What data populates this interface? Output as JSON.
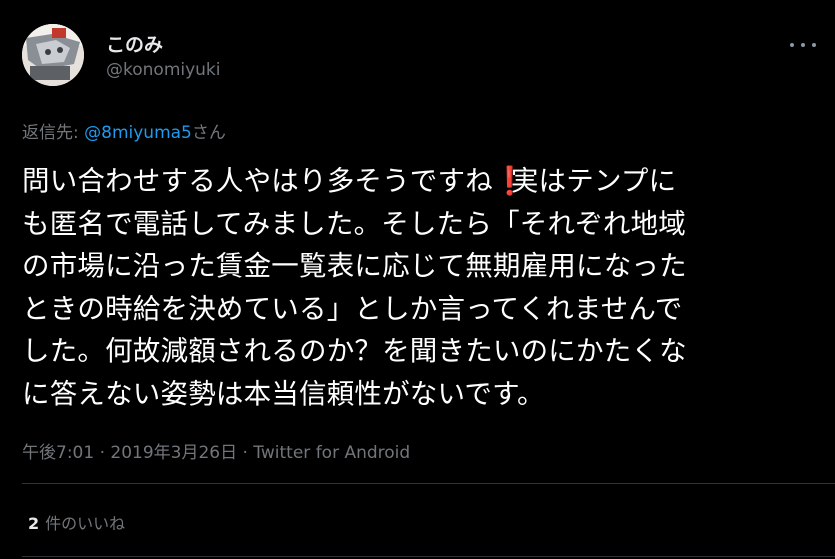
{
  "user": {
    "display_name": "このみ",
    "handle": "@konomiyuki"
  },
  "more_icon": "more-horizontal-icon",
  "reply": {
    "prefix": "返信先: ",
    "mention": "@8miyuma5",
    "suffix": "さん"
  },
  "tweet": {
    "lines": [
      {
        "before": "問い合わせする人やはり多そうですね",
        "emoji": "❗",
        "after": "実はテンプに"
      },
      {
        "text": "も匿名で電話してみました。そしたら「それぞれ地域"
      },
      {
        "text": "の市場に沿った賃金一覧表に応じて無期雇用になった"
      },
      {
        "text": "ときの時給を決めている」としか言ってくれませんで"
      },
      {
        "text": "した。何故減額されるのか？を聞きたいのにかたくな"
      },
      {
        "text": "に答えない姿勢は本当信頼性がないです。"
      }
    ]
  },
  "meta": "午後7:01 · 2019年3月26日 · Twitter for Android",
  "likes": {
    "count": "2",
    "label": "件のいいね"
  },
  "colors": {
    "background": "#000000",
    "text_primary": "#ffffff",
    "text_secondary": "#71767b",
    "link": "#1d9bf0",
    "divider": "#2f3336",
    "emoji_red": "#dd2e44"
  }
}
